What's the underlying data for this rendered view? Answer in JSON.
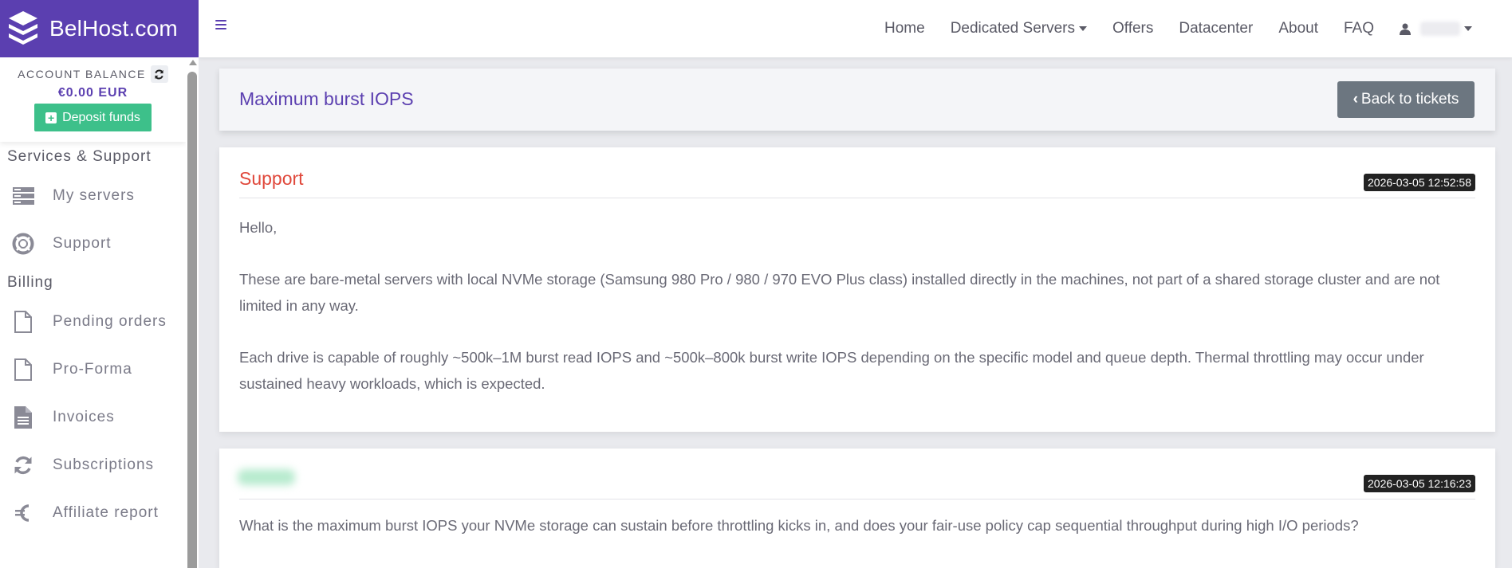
{
  "brand": {
    "name": "BelHost.com"
  },
  "nav": {
    "items": [
      {
        "label": "Home",
        "dropdown": false
      },
      {
        "label": "Dedicated Servers",
        "dropdown": true
      },
      {
        "label": "Offers",
        "dropdown": false
      },
      {
        "label": "Datacenter",
        "dropdown": false
      },
      {
        "label": "About",
        "dropdown": false
      },
      {
        "label": "FAQ",
        "dropdown": false
      }
    ]
  },
  "sidebar": {
    "balance_label": "ACCOUNT BALANCE",
    "balance_amount": "€0.00 EUR",
    "deposit_label": "Deposit funds",
    "sections": [
      {
        "title": "Services & Support",
        "items": [
          {
            "label": "My servers",
            "icon": "server-icon"
          },
          {
            "label": "Support",
            "icon": "lifebuoy-icon"
          }
        ]
      },
      {
        "title": "Billing",
        "items": [
          {
            "label": "Pending orders",
            "icon": "file-icon"
          },
          {
            "label": "Pro-Forma",
            "icon": "file-icon"
          },
          {
            "label": "Invoices",
            "icon": "file-text-icon"
          },
          {
            "label": "Subscriptions",
            "icon": "sync-icon"
          },
          {
            "label": "Affiliate report",
            "icon": "euro-icon"
          }
        ]
      }
    ]
  },
  "ticket": {
    "title": "Maximum burst IOPS",
    "back_label": "Back to tickets",
    "messages": [
      {
        "author": "Support",
        "timestamp": "2026-03-05 12:52:58",
        "paragraphs": [
          "Hello,",
          "These are bare-metal servers with local NVMe storage (Samsung 980 Pro / 980 / 970 EVO Plus class) installed directly in the machines, not part of a shared storage cluster and are not limited in any way.",
          "Each drive is capable of roughly ~500k–1M burst read IOPS and ~500k–800k burst write IOPS depending on the specific model and queue depth. Thermal throttling may occur under sustained heavy workloads, which is expected."
        ]
      },
      {
        "author": "",
        "timestamp": "2026-03-05 12:16:23",
        "paragraphs": [
          "What is the maximum burst IOPS your NVMe storage can sustain before throttling kicks in, and does your fair-use policy cap sequential throughput during high I/O periods?"
        ]
      }
    ]
  },
  "colors": {
    "brand": "#5b3fb0",
    "deposit": "#3dc08a",
    "support_author": "#e0483b",
    "back_button": "#6c7680"
  }
}
